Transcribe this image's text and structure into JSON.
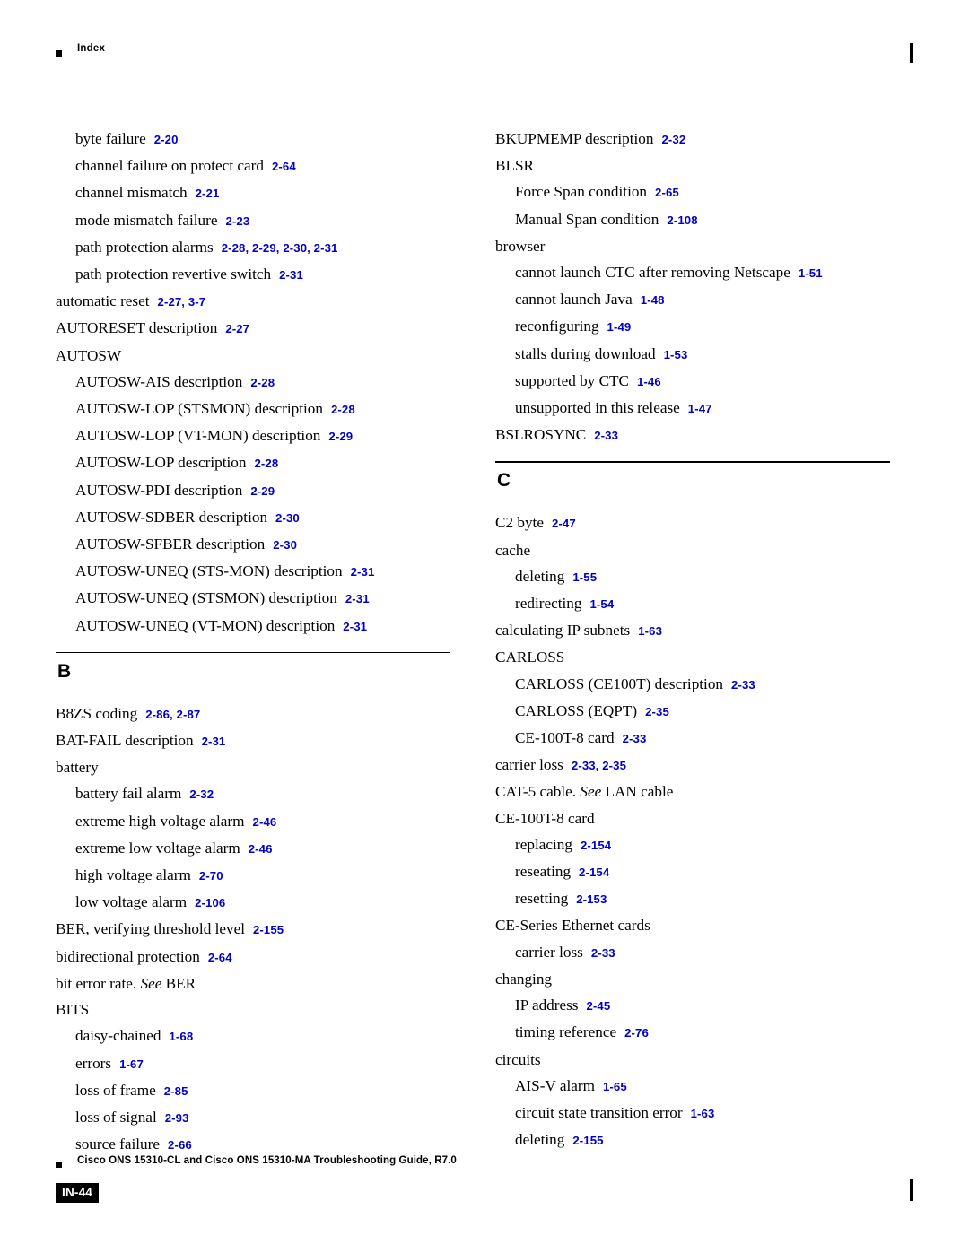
{
  "header": {
    "marker": "square-bullet",
    "title": "Index"
  },
  "footer": {
    "text": "Cisco ONS 15310-CL and Cisco ONS 15310-MA Troubleshooting Guide, R7.0",
    "page_label": "IN-44"
  },
  "columns": {
    "left": [
      {
        "level": 1,
        "text": "byte failure",
        "pages": "2-20"
      },
      {
        "level": 1,
        "text": "channel failure on protect card",
        "pages": "2-64"
      },
      {
        "level": 1,
        "text": "channel mismatch",
        "pages": "2-21"
      },
      {
        "level": 1,
        "text": "mode mismatch failure",
        "pages": "2-23"
      },
      {
        "level": 1,
        "text": "path protection alarms",
        "pages": "2-28, 2-29, 2-30, 2-31"
      },
      {
        "level": 1,
        "text": "path protection revertive switch",
        "pages": "2-31"
      },
      {
        "level": 0,
        "text": "automatic reset",
        "pages": "2-27, 3-7"
      },
      {
        "level": 0,
        "text": "AUTORESET description",
        "pages": "2-27"
      },
      {
        "level": 0,
        "text": "AUTOSW",
        "pages": ""
      },
      {
        "level": 1,
        "text": "AUTOSW-AIS description",
        "pages": "2-28"
      },
      {
        "level": 1,
        "text": "AUTOSW-LOP (STSMON) description",
        "pages": "2-28"
      },
      {
        "level": 1,
        "text": "AUTOSW-LOP (VT-MON) description",
        "pages": "2-29"
      },
      {
        "level": 1,
        "text": "AUTOSW-LOP description",
        "pages": "2-28"
      },
      {
        "level": 1,
        "text": "AUTOSW-PDI description",
        "pages": "2-29"
      },
      {
        "level": 1,
        "text": "AUTOSW-SDBER description",
        "pages": "2-30"
      },
      {
        "level": 1,
        "text": "AUTOSW-SFBER description",
        "pages": "2-30"
      },
      {
        "level": 1,
        "text": "AUTOSW-UNEQ (STS-MON) description",
        "pages": "2-31"
      },
      {
        "level": 1,
        "text": "AUTOSW-UNEQ (STSMON) description",
        "pages": "2-31"
      },
      {
        "level": 1,
        "text": "AUTOSW-UNEQ (VT-MON) description",
        "pages": "2-31"
      },
      {
        "level": "section",
        "text": "B",
        "pages": ""
      },
      {
        "level": 0,
        "text": "B8ZS coding",
        "pages": "2-86, 2-87"
      },
      {
        "level": 0,
        "text": "BAT-FAIL description",
        "pages": "2-31"
      },
      {
        "level": 0,
        "text": "battery",
        "pages": ""
      },
      {
        "level": 1,
        "text": "battery fail alarm",
        "pages": "2-32"
      },
      {
        "level": 1,
        "text": "extreme high voltage alarm",
        "pages": "2-46"
      },
      {
        "level": 1,
        "text": "extreme low voltage alarm",
        "pages": "2-46"
      },
      {
        "level": 1,
        "text": "high voltage alarm",
        "pages": "2-70"
      },
      {
        "level": 1,
        "text": "low voltage alarm",
        "pages": "2-106"
      },
      {
        "level": 0,
        "text": "BER, verifying threshold level",
        "pages": "2-155"
      },
      {
        "level": 0,
        "text": "bidirectional protection",
        "pages": "2-64"
      },
      {
        "level": 0,
        "text": "bit error rate. See BER",
        "pages": "",
        "italic_from": "See "
      },
      {
        "level": 0,
        "text": "BITS",
        "pages": ""
      },
      {
        "level": 1,
        "text": "daisy-chained",
        "pages": "1-68"
      },
      {
        "level": 1,
        "text": "errors",
        "pages": "1-67"
      },
      {
        "level": 1,
        "text": "loss of frame",
        "pages": "2-85"
      },
      {
        "level": 1,
        "text": "loss of signal",
        "pages": "2-93"
      },
      {
        "level": 1,
        "text": "source failure",
        "pages": "2-66"
      }
    ],
    "right": [
      {
        "level": 0,
        "text": "BKUPMEMP description",
        "pages": "2-32"
      },
      {
        "level": 0,
        "text": "BLSR",
        "pages": ""
      },
      {
        "level": 1,
        "text": "Force Span condition",
        "pages": "2-65"
      },
      {
        "level": 1,
        "text": "Manual Span condition",
        "pages": "2-108"
      },
      {
        "level": 0,
        "text": "browser",
        "pages": ""
      },
      {
        "level": 1,
        "text": "cannot launch CTC after removing Netscape",
        "pages": "1-51"
      },
      {
        "level": 1,
        "text": "cannot launch Java",
        "pages": "1-48"
      },
      {
        "level": 1,
        "text": "reconfiguring",
        "pages": "1-49"
      },
      {
        "level": 1,
        "text": "stalls during download",
        "pages": "1-53"
      },
      {
        "level": 1,
        "text": "supported by CTC",
        "pages": "1-46"
      },
      {
        "level": 1,
        "text": "unsupported in this release",
        "pages": "1-47"
      },
      {
        "level": 0,
        "text": "BSLROSYNC",
        "pages": "2-33"
      },
      {
        "level": "section",
        "text": "C",
        "pages": ""
      },
      {
        "level": 0,
        "text": "C2 byte",
        "pages": "2-47"
      },
      {
        "level": 0,
        "text": "cache",
        "pages": ""
      },
      {
        "level": 1,
        "text": "deleting",
        "pages": "1-55"
      },
      {
        "level": 1,
        "text": "redirecting",
        "pages": "1-54"
      },
      {
        "level": 0,
        "text": "calculating IP subnets",
        "pages": "1-63"
      },
      {
        "level": 0,
        "text": "CARLOSS",
        "pages": ""
      },
      {
        "level": 1,
        "text": "CARLOSS (CE100T) description",
        "pages": "2-33"
      },
      {
        "level": 1,
        "text": "CARLOSS (EQPT)",
        "pages": "2-35"
      },
      {
        "level": 1,
        "text": "CE-100T-8 card",
        "pages": "2-33"
      },
      {
        "level": 0,
        "text": "carrier loss",
        "pages": "2-33, 2-35"
      },
      {
        "level": 0,
        "text": "CAT-5 cable. See LAN cable",
        "pages": "",
        "italic_from": "See "
      },
      {
        "level": 0,
        "text": "CE-100T-8 card",
        "pages": ""
      },
      {
        "level": 1,
        "text": "replacing",
        "pages": "2-154"
      },
      {
        "level": 1,
        "text": "reseating",
        "pages": "2-154"
      },
      {
        "level": 1,
        "text": "resetting",
        "pages": "2-153"
      },
      {
        "level": 0,
        "text": "CE-Series Ethernet cards",
        "pages": ""
      },
      {
        "level": 1,
        "text": "carrier loss",
        "pages": "2-33"
      },
      {
        "level": 0,
        "text": "changing",
        "pages": ""
      },
      {
        "level": 1,
        "text": "IP address",
        "pages": "2-45"
      },
      {
        "level": 1,
        "text": "timing reference",
        "pages": "2-76"
      },
      {
        "level": 0,
        "text": "circuits",
        "pages": ""
      },
      {
        "level": 1,
        "text": "AIS-V alarm",
        "pages": "1-65"
      },
      {
        "level": 1,
        "text": "circuit state transition error",
        "pages": "1-63"
      },
      {
        "level": 1,
        "text": "deleting",
        "pages": "2-155"
      }
    ]
  },
  "colors": {
    "page_reference": "#0000cc",
    "text": "#000000"
  }
}
